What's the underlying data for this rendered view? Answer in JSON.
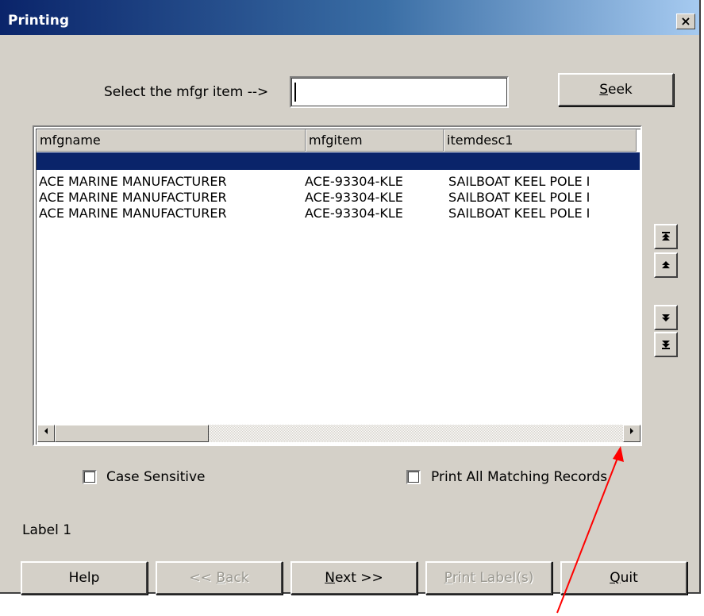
{
  "window": {
    "title": "Printing",
    "close_glyph": "×"
  },
  "search": {
    "label": "Select the mfgr item -->",
    "value": "",
    "seek_label_first": "S",
    "seek_label_rest": "eek"
  },
  "grid": {
    "columns": [
      "mfgname",
      "mfgitem",
      "itemdesc1"
    ],
    "rows": [
      [
        "ACE MARINE MANUFACTURER",
        "ACE-93304-KLE",
        "SAILBOAT KEEL POLE I"
      ],
      [
        "ACE MARINE MANUFACTURER",
        "ACE-93304-KLE",
        "SAILBOAT KEEL POLE I"
      ],
      [
        "ACE MARINE MANUFACTURER",
        "ACE-93304-KLE",
        "SAILBOAT KEEL POLE I"
      ]
    ],
    "scroll_left_icon": "scroll-left-arrow-icon",
    "scroll_right_icon": "scroll-right-arrow-icon"
  },
  "navigation": {
    "first_icon": "first-record-icon",
    "prev_icon": "previous-record-icon",
    "next_icon": "next-record-icon",
    "last_icon": "last-record-icon"
  },
  "options": {
    "case_sensitive_label": "Case Sensitive",
    "case_sensitive_checked": false,
    "print_all_label": "Print All Matching Records",
    "print_all_checked": false
  },
  "status": {
    "label": "Label 1"
  },
  "footer": {
    "help": "Help",
    "back_prefix": "<< ",
    "back_u": "B",
    "back_rest": "ack",
    "next_u": "N",
    "next_rest": "ext >>",
    "print_u": "P",
    "print_rest": "rint Label(s)",
    "quit_u": "Q",
    "quit_rest": "uit"
  },
  "annotation": {
    "color": "#ff0000"
  }
}
